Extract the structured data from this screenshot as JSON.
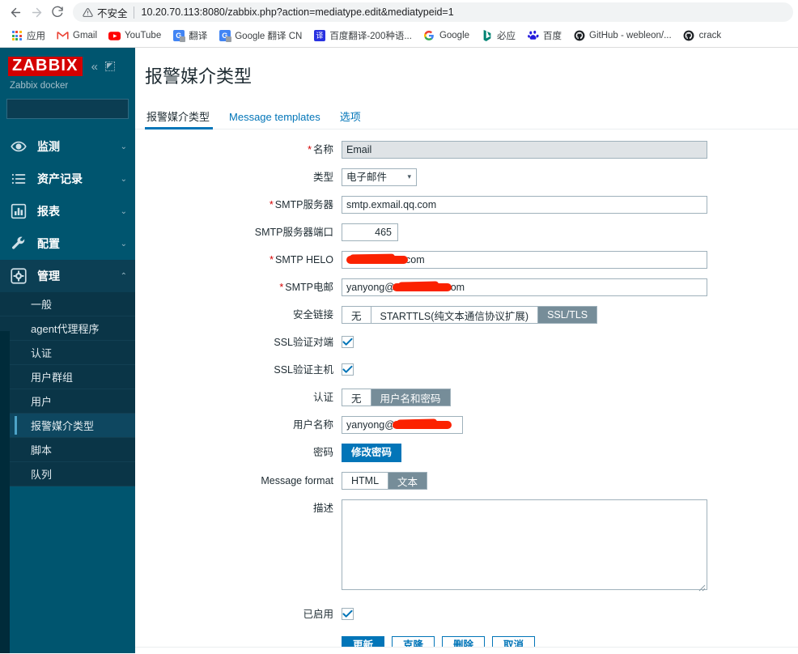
{
  "browser": {
    "back_icon": "back-arrow-icon",
    "forward_icon": "forward-arrow-icon",
    "reload_icon": "reload-icon",
    "security_label": "不安全",
    "url": "10.20.70.113:8080/zabbix.php?action=mediatype.edit&mediatypeid=1",
    "bookmarks": [
      {
        "label": "应用",
        "icon": "apps-grid-icon"
      },
      {
        "label": "Gmail",
        "icon": "gmail-icon"
      },
      {
        "label": "YouTube",
        "icon": "youtube-icon"
      },
      {
        "label": "翻译",
        "icon": "google-translate-icon"
      },
      {
        "label": "Google 翻译 CN",
        "icon": "google-translate-icon"
      },
      {
        "label": "百度翻译-200种语...",
        "icon": "baidu-translate-icon"
      },
      {
        "label": "Google",
        "icon": "google-icon"
      },
      {
        "label": "必应",
        "icon": "bing-icon"
      },
      {
        "label": "百度",
        "icon": "baidu-icon"
      },
      {
        "label": "GitHub - webleon/...",
        "icon": "github-icon"
      },
      {
        "label": "crack",
        "icon": "github-icon"
      }
    ]
  },
  "sidebar": {
    "logo": "ZABBIX",
    "collapse_icon": "double-chevron-left-icon",
    "expand_icon": "expand-collapse-icon",
    "server_name": "Zabbix docker",
    "search_placeholder": "",
    "search_value": "",
    "search_icon": "search-icon",
    "nav": [
      {
        "label": "监测",
        "icon": "eye-icon",
        "chevron": "⌄",
        "active": false
      },
      {
        "label": "资产记录",
        "icon": "list-icon",
        "chevron": "⌄",
        "active": false
      },
      {
        "label": "报表",
        "icon": "bar-chart-icon",
        "chevron": "⌄",
        "active": false
      },
      {
        "label": "配置",
        "icon": "wrench-icon",
        "chevron": "⌄",
        "active": false
      },
      {
        "label": "管理",
        "icon": "gear-icon",
        "chevron": "⌃",
        "active": true
      }
    ],
    "submenu": [
      {
        "label": "一般",
        "selected": false
      },
      {
        "label": "agent代理程序",
        "selected": false
      },
      {
        "label": "认证",
        "selected": false
      },
      {
        "label": "用户群组",
        "selected": false
      },
      {
        "label": "用户",
        "selected": false
      },
      {
        "label": "报警媒介类型",
        "selected": true
      },
      {
        "label": "脚本",
        "selected": false
      },
      {
        "label": "队列",
        "selected": false
      }
    ]
  },
  "main": {
    "page_title": "报警媒介类型",
    "tabs": [
      {
        "label": "报警媒介类型",
        "active": true
      },
      {
        "label": "Message templates",
        "active": false
      },
      {
        "label": "选项",
        "active": false
      }
    ],
    "form": {
      "name": {
        "label": "名称",
        "required": true,
        "value": "Email"
      },
      "type": {
        "label": "类型",
        "required": false,
        "value": "电子邮件",
        "options": [
          "电子邮件"
        ],
        "chevron_icon": "chevron-down-icon"
      },
      "smtp_server": {
        "label": "SMTP服务器",
        "required": true,
        "value": "smtp.exmail.qq.com"
      },
      "smtp_port": {
        "label": "SMTP服务器端口",
        "required": false,
        "value": "465"
      },
      "smtp_helo": {
        "label": "SMTP HELO",
        "required": true,
        "value": "com",
        "redacted": true
      },
      "smtp_email": {
        "label": "SMTP电邮",
        "required": true,
        "value_prefix": "yanyong@",
        "value_suffix": "com",
        "redacted": true
      },
      "security": {
        "label": "安全链接",
        "required": false,
        "options": [
          "无",
          "STARTTLS(纯文本通信协议扩展)",
          "SSL/TLS"
        ],
        "selected": "SSL/TLS"
      },
      "ssl_verify_peer": {
        "label": "SSL验证对端",
        "required": false,
        "checked": true
      },
      "ssl_verify_host": {
        "label": "SSL验证主机",
        "required": false,
        "checked": true
      },
      "authentication": {
        "label": "认证",
        "required": false,
        "options": [
          "无",
          "用户名和密码"
        ],
        "selected": "用户名和密码"
      },
      "username": {
        "label": "用户名称",
        "required": false,
        "value_prefix": "yanyong@",
        "value_suffix": ".",
        "redacted": true
      },
      "password": {
        "label": "密码",
        "required": false,
        "button_label": "修改密码"
      },
      "message_format": {
        "label": "Message format",
        "required": false,
        "options": [
          "HTML",
          "文本"
        ],
        "selected": "文本"
      },
      "description": {
        "label": "描述",
        "required": false,
        "value": "",
        "resize_icon": "resize-handle-icon"
      },
      "enabled": {
        "label": "已启用",
        "required": false,
        "checked": true
      }
    },
    "buttons": [
      {
        "label": "更新",
        "primary": true
      },
      {
        "label": "克隆",
        "primary": false
      },
      {
        "label": "删除",
        "primary": false
      },
      {
        "label": "取消",
        "primary": false
      }
    ]
  }
}
